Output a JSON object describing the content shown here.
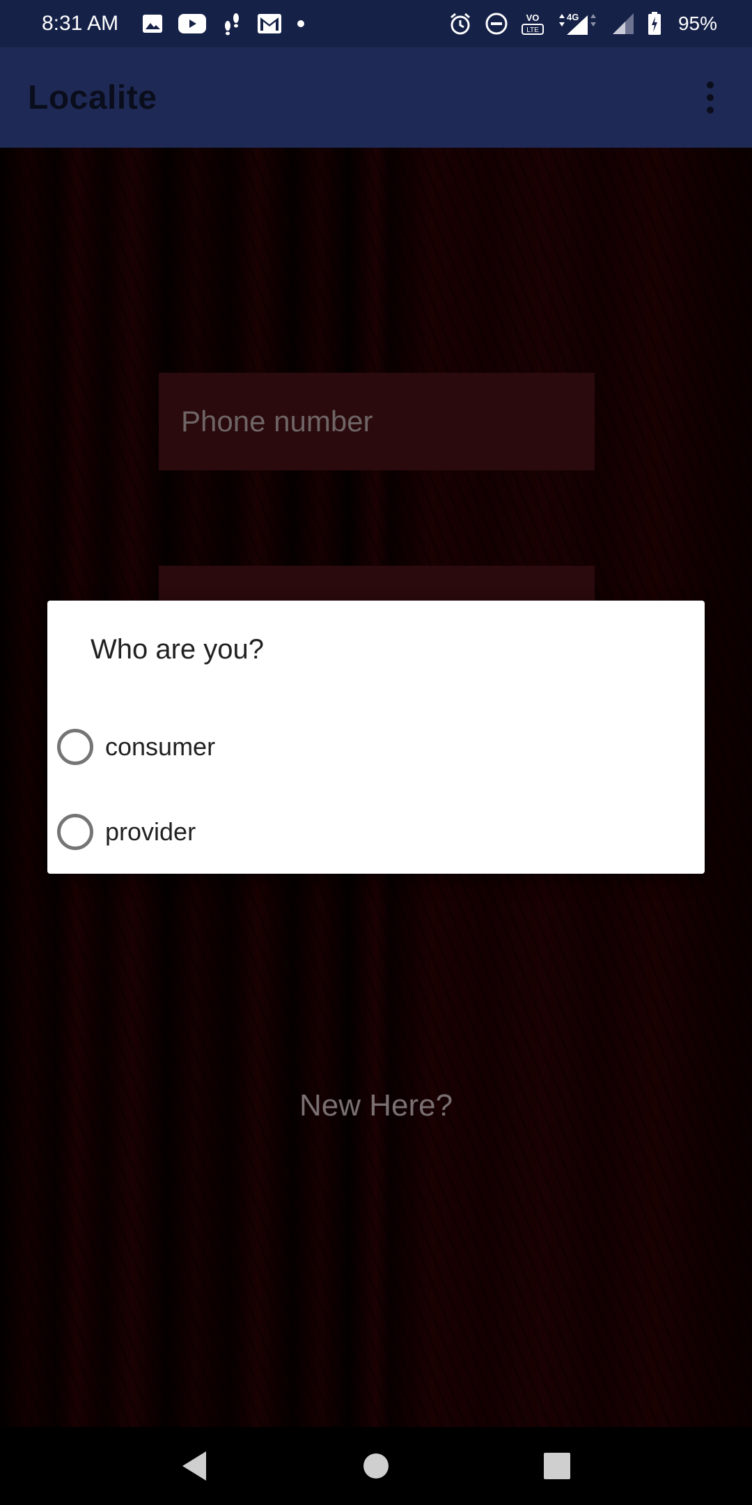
{
  "status_bar": {
    "time": "8:31 AM",
    "battery": "95%",
    "left_icons": [
      "image-icon",
      "youtube-icon",
      "footsteps-icon",
      "gmail-icon",
      "dot-icon"
    ],
    "right_icons": [
      "alarm-icon",
      "do-not-disturb-icon",
      "volte-icon",
      "4g-signal-icon",
      "signal-icon",
      "battery-charging-icon"
    ],
    "network_label": "4G"
  },
  "app_bar": {
    "title": "Localite",
    "menu_icon": "more-vert-icon"
  },
  "form": {
    "phone_placeholder": "Phone number",
    "new_here": "New Here?"
  },
  "dialog": {
    "title": "Who are you?",
    "options": [
      {
        "label": "consumer",
        "selected": false
      },
      {
        "label": "provider",
        "selected": false
      }
    ]
  },
  "nav_bar": {
    "icons": [
      "back-icon",
      "home-icon",
      "recents-icon"
    ]
  },
  "colors": {
    "status_bar": "#162148",
    "app_bar": "#1e2a55",
    "dialog_bg": "#ffffff",
    "radio_border": "#757575"
  }
}
